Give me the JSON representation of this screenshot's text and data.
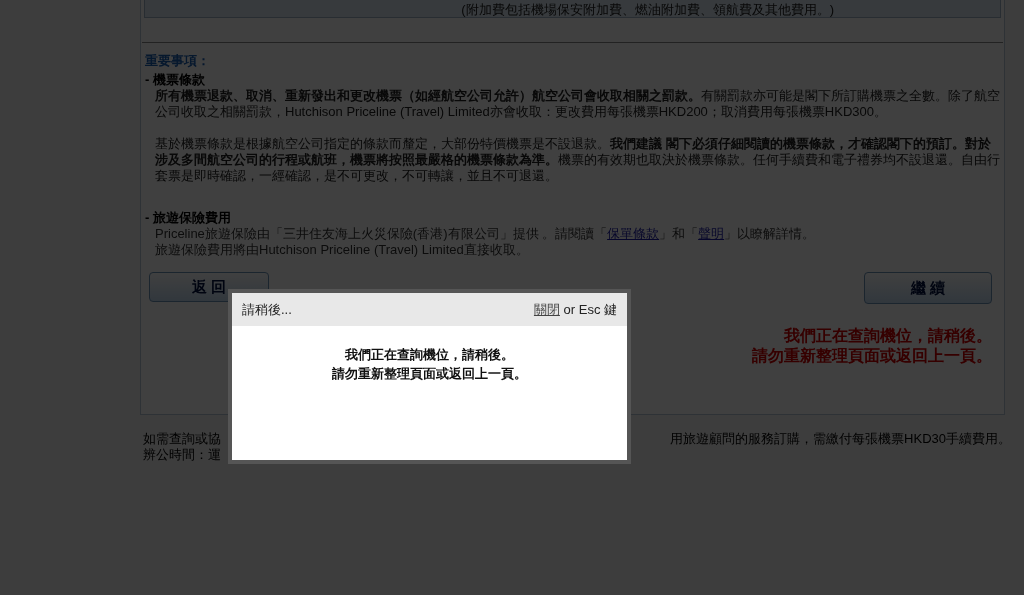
{
  "fare_box": {
    "note": "(附加費包括機場保安附加費、燃油附加費、領航費及其他費用。)"
  },
  "notice": {
    "heading": "重要事項：",
    "sections": [
      {
        "title": "- 機票條款",
        "paragraphs": [
          "**所有機票退款、取消、重新發出和更改機票（如經航空公司允許）航空公司會收取相關之罰款。**有關罰款亦可能是閣下所訂購機票之全數。除了航空公司收取之相關罰款，Hutchison Priceline (Travel) Limited亦會收取：更改費用每張機票HKD200；取消費用每張機票HKD300。",
          "基於機票條款是根據航空公司指定的條款而釐定，大部份特價機票是不設退款。**我們建議 閣下必須仔細閱讀的機票條款，才確認閣下的預訂。對於涉及多間航空公司的行程或航班，機票將按照最嚴格的機票條款為準。**機票的有效期也取決於機票條款。任何手續費和電子禮券均不設退還。自由行套票是即時確認，一經確認，是不可更改，不可轉讓，並且不可退還。"
        ]
      },
      {
        "title": "- 旅遊保險費用",
        "insurance": {
          "before": "Priceline旅遊保險由「三井住友海上火災保險(香港)有限公司」提供 。請閱讀「",
          "link1": "保單條款",
          "middle": "」和「",
          "link2": "聲明",
          "after": "」以瞭解詳情。"
        },
        "paragraphs": [
          "旅遊保險費用將由Hutchison Priceline (Travel) Limited直接收取。"
        ]
      }
    ]
  },
  "buttons": {
    "back": "返 回",
    "continue": "繼 續"
  },
  "status_lines": [
    "我們正在查詢機位，請稍後。",
    "請勿重新整理頁面或返回上一頁。"
  ],
  "footer": {
    "line1_left": "如需查詢或協",
    "line1_right": "用旅遊顧問的服務訂購，需繳付每張機票HKD30手續費用。",
    "line2_left": "辨公時間：運"
  },
  "dialog": {
    "title": "請稍後...",
    "close_link": "關閉",
    "close_hint": " or Esc 鍵",
    "lines": [
      "我們正在查詢機位，請稍後。",
      "請勿重新整理頁面或返回上一頁。"
    ]
  }
}
